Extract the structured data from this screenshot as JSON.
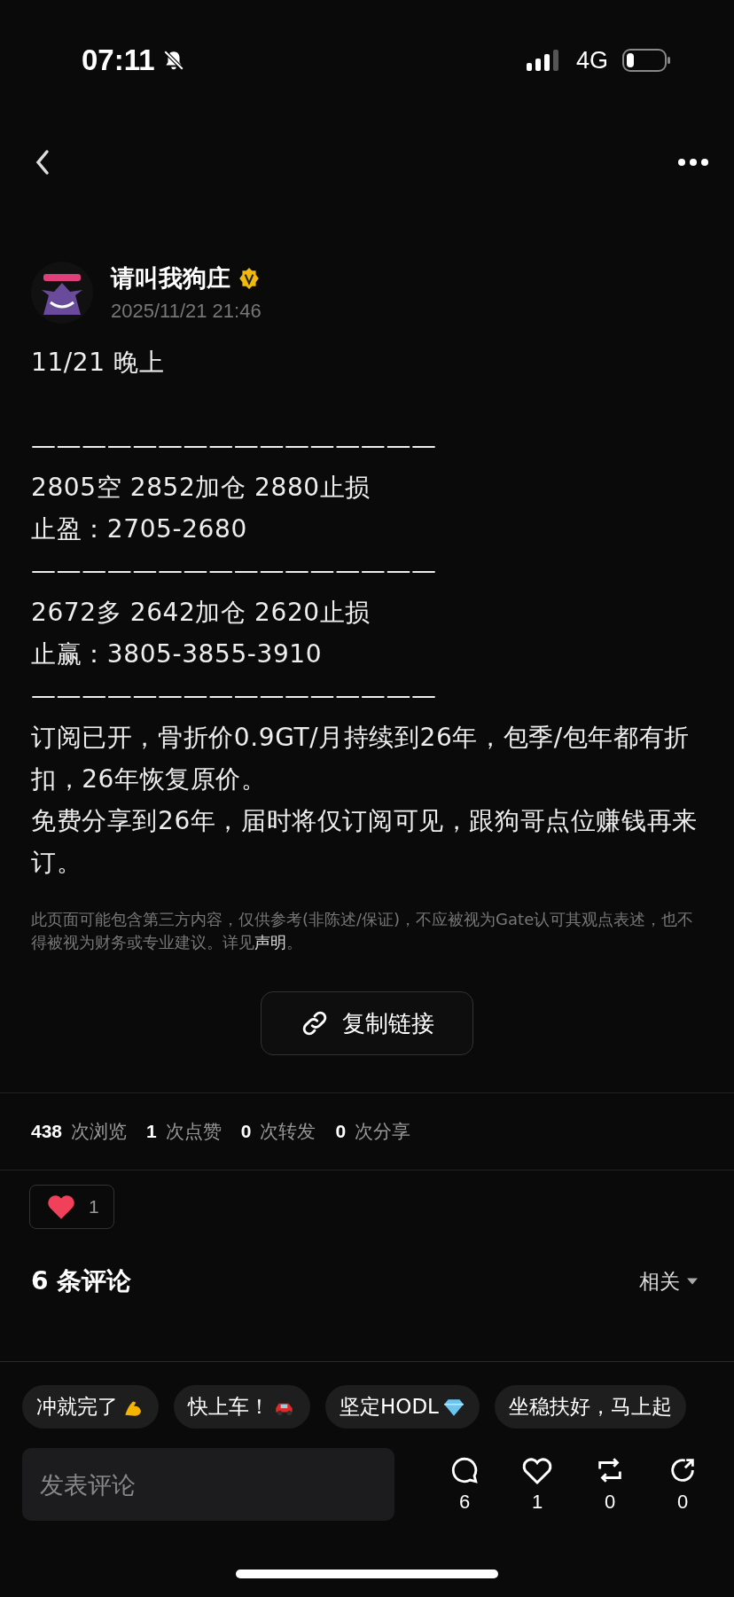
{
  "status_bar": {
    "time": "07:11",
    "network": "4G"
  },
  "post": {
    "author": "请叫我狗庄",
    "verified": true,
    "time": "2025/11/21 21:46",
    "lines": [
      {
        "kind": "text",
        "text": "11/21  晚上"
      },
      {
        "kind": "gap"
      },
      {
        "kind": "text",
        "text": "————————————————"
      },
      {
        "kind": "text",
        "text": "2805空 2852加仓 2880止损"
      },
      {
        "kind": "text",
        "text": "止盈：2705-2680"
      },
      {
        "kind": "text",
        "text": "————————————————"
      },
      {
        "kind": "text",
        "text": "2672多 2642加仓 2620止损"
      },
      {
        "kind": "text",
        "text": "止赢：3805-3855-3910"
      },
      {
        "kind": "text",
        "text": "————————————————"
      },
      {
        "kind": "text",
        "text": "订阅已开，骨折价0.9GT/月持续到26年，包季/包年都有折扣，26年恢复原价。"
      },
      {
        "kind": "text",
        "text": "免费分享到26年，届时将仅订阅可见，跟狗哥点位赚钱再来订。"
      }
    ],
    "disclaimer": "此页面可能包含第三方内容，仅供参考(非陈述/保证)，不应被视为Gate认可其观点表述，也不得被视为财务或专业建议。详见",
    "disclaimer_link": "声明",
    "disclaimer_end": "。",
    "copy_button": "复制链接"
  },
  "stats": [
    {
      "count": "438",
      "label": "次浏览"
    },
    {
      "count": "1",
      "label": "次点赞"
    },
    {
      "count": "0",
      "label": "次转发"
    },
    {
      "count": "0",
      "label": "次分享"
    }
  ],
  "reaction": {
    "count": "1"
  },
  "comments": {
    "title": "6 条评论",
    "sort": "相关"
  },
  "quick_replies": [
    {
      "text": "冲就完了",
      "kind": "arm"
    },
    {
      "text": "快上车！",
      "kind": "car"
    },
    {
      "text": "坚定HODL",
      "kind": "gem"
    },
    {
      "text": "坐稳扶好，马上起",
      "kind": "none"
    }
  ],
  "composer": {
    "placeholder": "发表评论"
  },
  "actions": [
    {
      "kind": "comment",
      "count": "6"
    },
    {
      "kind": "like",
      "count": "1"
    },
    {
      "kind": "repost",
      "count": "0"
    },
    {
      "kind": "share",
      "count": "0"
    }
  ]
}
